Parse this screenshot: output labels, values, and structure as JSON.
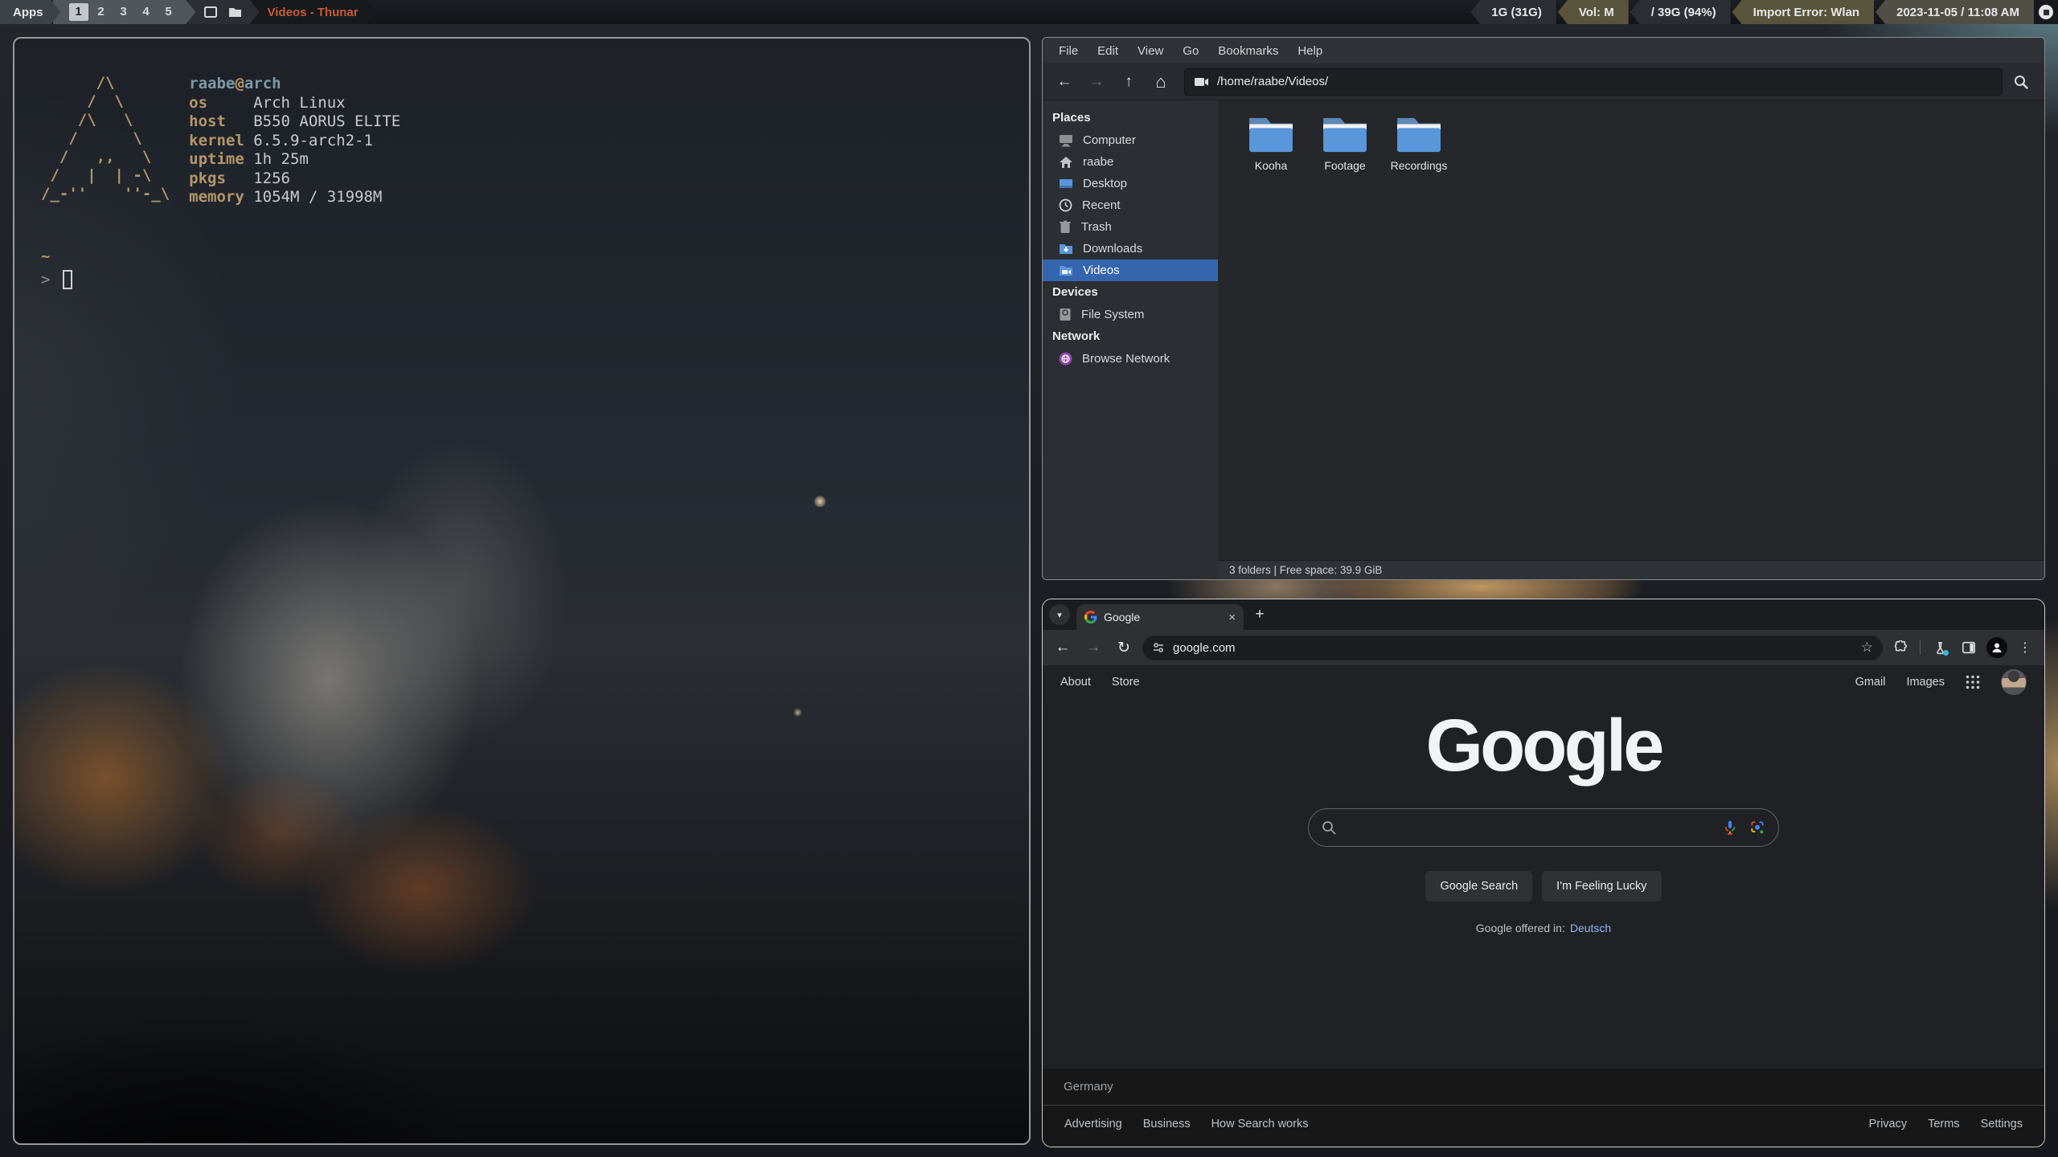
{
  "colors": {
    "panel_title_orange": "#c35d35",
    "arch_tan": "#b3976a",
    "user_host_blue": "#7e9aaa",
    "selection_blue": "#3566ad",
    "folder_blue": "#5997da",
    "link_blue": "#8ab4f8",
    "network_purple": "#8e44ad",
    "page_bg": "#202124"
  },
  "panel": {
    "apps_label": "Apps",
    "workspaces": [
      "1",
      "2",
      "3",
      "4",
      "5"
    ],
    "active_workspace": "1",
    "window_title": "Videos - Thunar",
    "status": [
      {
        "label": "1G (31G)"
      },
      {
        "label": "Vol: M"
      },
      {
        "label": "/ 39G (94%)"
      },
      {
        "label": "Import Error: Wlan"
      },
      {
        "label": "2023-11-05 / 11:08 AM"
      }
    ]
  },
  "terminal": {
    "ascii": "      /\\\n     /  \\\n    /\\   \\\n   /      \\\n  /   ,,   \\\n /   |  | -\\\n/_-''    ''-_\\",
    "user": "raabe",
    "at": "@",
    "host": "arch",
    "fetch": [
      {
        "label": "os",
        "value": "Arch Linux"
      },
      {
        "label": "host",
        "value": "B550 AORUS ELITE"
      },
      {
        "label": "kernel",
        "value": "6.5.9-arch2-1"
      },
      {
        "label": "uptime",
        "value": "1h 25m"
      },
      {
        "label": "pkgs",
        "value": "1256"
      },
      {
        "label": "memory",
        "value": "1054M / 31998M"
      }
    ],
    "cwd": "~",
    "prompt": ">"
  },
  "thunar": {
    "menu": [
      "File",
      "Edit",
      "View",
      "Go",
      "Bookmarks",
      "Help"
    ],
    "path": "/home/raabe/Videos/",
    "sidebar": {
      "places_header": "Places",
      "places": [
        {
          "label": "Computer"
        },
        {
          "label": "raabe"
        },
        {
          "label": "Desktop"
        },
        {
          "label": "Recent"
        },
        {
          "label": "Trash"
        },
        {
          "label": "Downloads"
        },
        {
          "label": "Videos"
        }
      ],
      "devices_header": "Devices",
      "devices": [
        {
          "label": "File System"
        }
      ],
      "network_header": "Network",
      "network": [
        {
          "label": "Browse Network"
        }
      ]
    },
    "folders": [
      "Kooha",
      "Footage",
      "Recordings"
    ],
    "statusbar": "3 folders | Free space: 39.9 GiB"
  },
  "chrome": {
    "tab_title": "Google",
    "url": "google.com",
    "page": {
      "header_left": [
        "About",
        "Store"
      ],
      "header_right": [
        "Gmail",
        "Images"
      ],
      "logo": "Google",
      "search_placeholder": "",
      "buttons": [
        "Google Search",
        "I'm Feeling Lucky"
      ],
      "offered_in": "Google offered in:",
      "offered_lang": "Deutsch",
      "country": "Germany",
      "footer_left": [
        "Advertising",
        "Business",
        "How Search works"
      ],
      "footer_right": [
        "Privacy",
        "Terms",
        "Settings"
      ]
    }
  }
}
